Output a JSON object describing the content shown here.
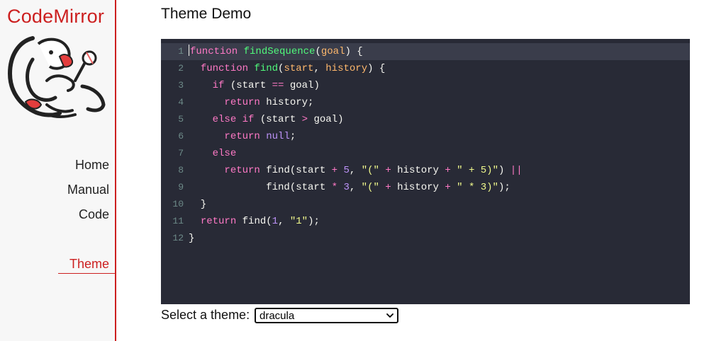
{
  "sidebar": {
    "brand": "CodeMirror",
    "nav": [
      {
        "label": "Home"
      },
      {
        "label": "Manual"
      },
      {
        "label": "Code"
      },
      {
        "label": "Theme"
      }
    ],
    "active": "Theme",
    "accent_color": "#cc1f1f"
  },
  "main": {
    "title": "Theme Demo",
    "editor": {
      "theme_bg": "#282a36",
      "line_numbers": [
        "1",
        "2",
        "3",
        "4",
        "5",
        "6",
        "7",
        "8",
        "9",
        "10",
        "11",
        "12"
      ],
      "active_line": 1,
      "lines": [
        [
          [
            "kw",
            "function"
          ],
          [
            "pl",
            " "
          ],
          [
            "def",
            "findSequence"
          ],
          [
            "pl",
            "("
          ],
          [
            "var",
            "goal"
          ],
          [
            "pl",
            ") {"
          ]
        ],
        [
          [
            "pl",
            "  "
          ],
          [
            "kw",
            "function"
          ],
          [
            "pl",
            " "
          ],
          [
            "def",
            "find"
          ],
          [
            "pl",
            "("
          ],
          [
            "var",
            "start"
          ],
          [
            "pl",
            ", "
          ],
          [
            "var",
            "history"
          ],
          [
            "pl",
            ") {"
          ]
        ],
        [
          [
            "pl",
            "    "
          ],
          [
            "kw",
            "if"
          ],
          [
            "pl",
            " (start "
          ],
          [
            "op",
            "=="
          ],
          [
            "pl",
            " goal)"
          ]
        ],
        [
          [
            "pl",
            "      "
          ],
          [
            "kw",
            "return"
          ],
          [
            "pl",
            " history;"
          ]
        ],
        [
          [
            "pl",
            "    "
          ],
          [
            "kw",
            "else"
          ],
          [
            "pl",
            " "
          ],
          [
            "kw",
            "if"
          ],
          [
            "pl",
            " (start "
          ],
          [
            "op",
            ">"
          ],
          [
            "pl",
            " goal)"
          ]
        ],
        [
          [
            "pl",
            "      "
          ],
          [
            "kw",
            "return"
          ],
          [
            "pl",
            " "
          ],
          [
            "atom",
            "null"
          ],
          [
            "pl",
            ";"
          ]
        ],
        [
          [
            "pl",
            "    "
          ],
          [
            "kw",
            "else"
          ]
        ],
        [
          [
            "pl",
            "      "
          ],
          [
            "kw",
            "return"
          ],
          [
            "pl",
            " find(start "
          ],
          [
            "op",
            "+"
          ],
          [
            "pl",
            " "
          ],
          [
            "num",
            "5"
          ],
          [
            "pl",
            ", "
          ],
          [
            "str",
            "\"(\""
          ],
          [
            "pl",
            " "
          ],
          [
            "op",
            "+"
          ],
          [
            "pl",
            " history "
          ],
          [
            "op",
            "+"
          ],
          [
            "pl",
            " "
          ],
          [
            "str",
            "\" + 5)\""
          ],
          [
            "pl",
            ") "
          ],
          [
            "op",
            "||"
          ]
        ],
        [
          [
            "pl",
            "             find(start "
          ],
          [
            "op",
            "*"
          ],
          [
            "pl",
            " "
          ],
          [
            "num",
            "3"
          ],
          [
            "pl",
            ", "
          ],
          [
            "str",
            "\"(\""
          ],
          [
            "pl",
            " "
          ],
          [
            "op",
            "+"
          ],
          [
            "pl",
            " history "
          ],
          [
            "op",
            "+"
          ],
          [
            "pl",
            " "
          ],
          [
            "str",
            "\" * 3)\""
          ],
          [
            "pl",
            ");"
          ]
        ],
        [
          [
            "pl",
            "  }"
          ]
        ],
        [
          [
            "pl",
            "  "
          ],
          [
            "kw",
            "return"
          ],
          [
            "pl",
            " find("
          ],
          [
            "num",
            "1"
          ],
          [
            "pl",
            ", "
          ],
          [
            "str",
            "\"1\""
          ],
          [
            "pl",
            ");"
          ]
        ],
        [
          [
            "pl",
            "}"
          ]
        ]
      ]
    },
    "theme_select": {
      "label": "Select a theme:",
      "value": "dracula"
    }
  }
}
